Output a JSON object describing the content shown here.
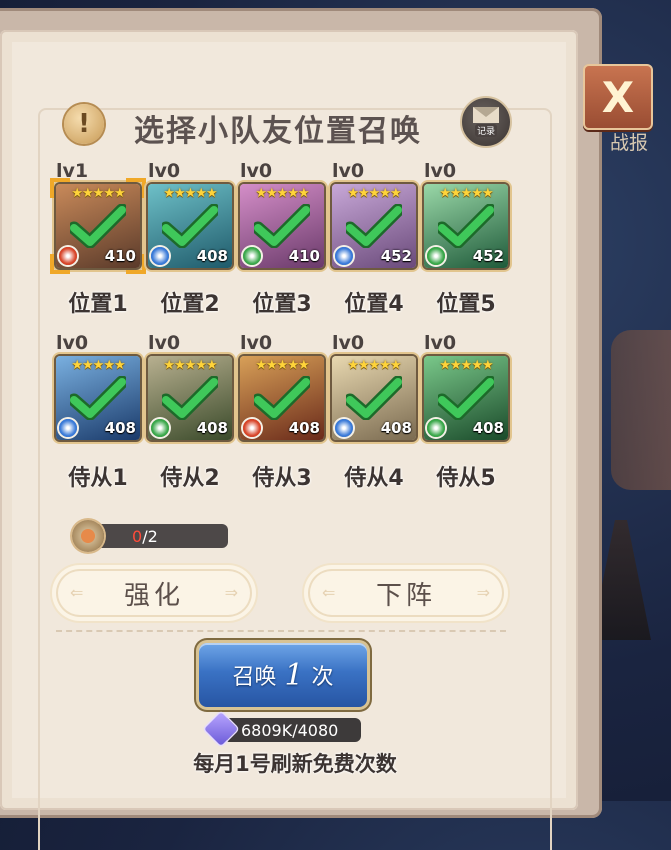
{
  "header": {
    "title": "选择小队友位置召唤",
    "records_label": "记录",
    "close_symbol": "X",
    "battle_report": "战报"
  },
  "positions": [
    {
      "level": "lv1",
      "label": "位置1",
      "power": "410",
      "stars": "★★★★★",
      "selected": true,
      "element": "fire",
      "art": [
        "#5a3a2a",
        "#c98a5a"
      ]
    },
    {
      "level": "lv0",
      "label": "位置2",
      "power": "408",
      "stars": "★★★★★",
      "selected": false,
      "element": "ice",
      "art": [
        "#1f5a6a",
        "#6ec0c8"
      ]
    },
    {
      "level": "lv0",
      "label": "位置3",
      "power": "410",
      "stars": "★★★★★",
      "selected": false,
      "element": "wind",
      "art": [
        "#6a3a6a",
        "#d48ec8"
      ]
    },
    {
      "level": "lv0",
      "label": "位置4",
      "power": "452",
      "stars": "★★★★★",
      "selected": false,
      "element": "ice",
      "art": [
        "#6a4a7a",
        "#c8a8d8"
      ]
    },
    {
      "level": "lv0",
      "label": "位置5",
      "power": "452",
      "stars": "★★★★★",
      "selected": false,
      "element": "wind",
      "art": [
        "#1f5a3a",
        "#9ad8a8"
      ]
    }
  ],
  "attendants": [
    {
      "level": "lv0",
      "label": "侍从1",
      "power": "408",
      "stars": "★★★★★",
      "element": "ice",
      "art": [
        "#1a3a6a",
        "#7ab0e0"
      ]
    },
    {
      "level": "lv0",
      "label": "侍从2",
      "power": "408",
      "stars": "★★★★★",
      "element": "wind",
      "art": [
        "#3a4a2a",
        "#b8b090"
      ]
    },
    {
      "level": "lv0",
      "label": "侍从3",
      "power": "408",
      "stars": "★★★★★",
      "element": "fire",
      "art": [
        "#6a2a1a",
        "#d8a058"
      ]
    },
    {
      "level": "lv0",
      "label": "侍从4",
      "power": "408",
      "stars": "★★★★★",
      "element": "ice",
      "art": [
        "#7a6a50",
        "#e8d8b0"
      ]
    },
    {
      "level": "lv0",
      "label": "侍从5",
      "power": "408",
      "stars": "★★★★★",
      "element": "wind",
      "art": [
        "#1a4a2a",
        "#7ac88a"
      ]
    }
  ],
  "progress": {
    "current": "0",
    "total": "/2"
  },
  "buttons": {
    "enhance": "强化",
    "unequip": "下阵"
  },
  "summon": {
    "prefix": "召唤",
    "count": "1",
    "suffix": "次"
  },
  "cost": {
    "text": "6809K/4080"
  },
  "notice": "每月1号刷新免费次数",
  "colors": {
    "check": "#3fc85a",
    "fire": "#d8452a",
    "ice": "#3a7ad8",
    "wind": "#3aa84a",
    "bracket": "#f0a828"
  }
}
